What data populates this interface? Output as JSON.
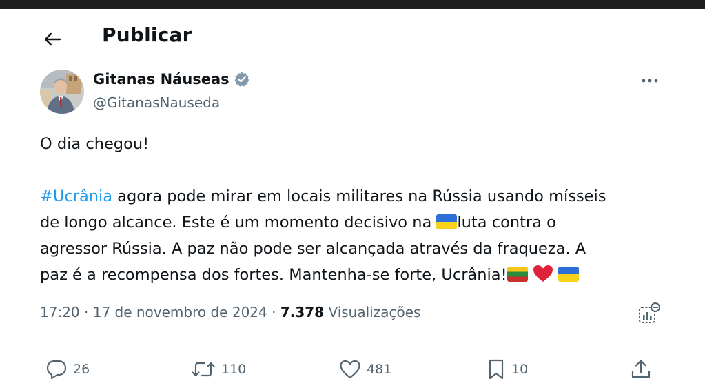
{
  "header": {
    "title": "Publicar"
  },
  "author": {
    "name": "Gitanas Náuseas",
    "handle": "@GitanasNauseda"
  },
  "tweet": {
    "line1": "O dia chegou!",
    "line2_hashtag": "#Ucrânia",
    "line2_rest": " agora pode mirar em locais militares na Rússia usando mísseis",
    "line3_before_flag": "de longo alcance. Este é um momento decisivo na ",
    "line3_after_flag": "luta contra o",
    "line4": "agressor Rússia. A paz não pode ser alcançada através da fraqueza. A",
    "line5": "paz é a recompensa dos fortes. Mantenha-se forte, Ucrânia!"
  },
  "meta": {
    "time": "17:20",
    "separator1": " · ",
    "date": "17 de novembro de 2024",
    "separator2": " · ",
    "views_count": "7.378",
    "views_label": " Visualizações"
  },
  "actions": {
    "replies": "26",
    "retweets": "110",
    "likes": "481",
    "bookmarks": "10"
  },
  "colors": {
    "accent": "#1d9bf0",
    "text": "#0f1419",
    "muted": "#536471",
    "verified": "#829aab"
  },
  "icons": {
    "back": "arrow-left-icon",
    "verified": "verified-badge-icon",
    "more": "more-dots-icon",
    "analytics": "analytics-icon",
    "reply": "reply-bubble-icon",
    "retweet": "retweet-icon",
    "like": "heart-icon",
    "bookmark": "bookmark-icon",
    "share": "share-icon"
  }
}
